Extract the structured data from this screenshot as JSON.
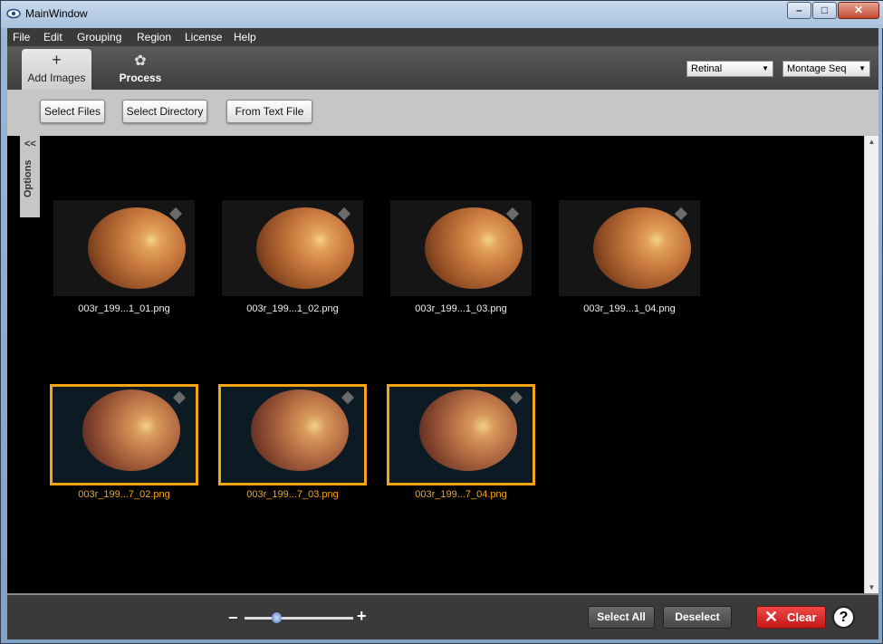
{
  "window": {
    "title": "MainWindow"
  },
  "menu": [
    "File",
    "Edit",
    "Grouping",
    "Region",
    "License",
    "Help"
  ],
  "tabs": {
    "add": {
      "label": "Add Images",
      "icon": "plus-icon"
    },
    "process": {
      "label": "Process",
      "icon": "flower-icon"
    }
  },
  "combos": {
    "type": "Retinal",
    "sequence": "Montage Seq"
  },
  "buttons": {
    "files": "Select Files",
    "directory": "Select Directory",
    "text_file": "From Text File",
    "select_all": "Select All",
    "deselect": "Deselect",
    "clear": "Clear",
    "help": "?"
  },
  "options": {
    "label": "Options",
    "chevron": "<<"
  },
  "thumbnails": [
    {
      "caption": "003r_199...1_01.png",
      "selected": false
    },
    {
      "caption": "003r_199...1_02.png",
      "selected": false
    },
    {
      "caption": "003r_199...1_03.png",
      "selected": false
    },
    {
      "caption": "003r_199...1_04.png",
      "selected": false
    },
    {
      "caption": "003r_199...7_02.png",
      "selected": true
    },
    {
      "caption": "003r_199...7_03.png",
      "selected": true
    },
    {
      "caption": "003r_199...7_04.png",
      "selected": true
    }
  ],
  "zoom": {
    "minus": "−",
    "plus": "+",
    "level": 0.3
  },
  "colors": {
    "selection": "#f6a414",
    "clear": "#d62020",
    "dark": "#3a3a3a"
  }
}
